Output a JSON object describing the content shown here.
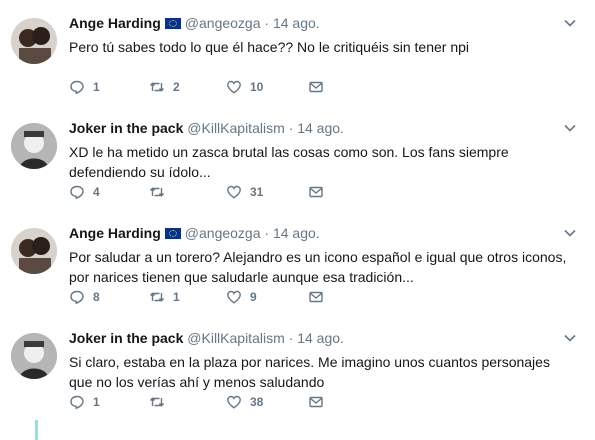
{
  "tweets": [
    {
      "name": "Ange Harding",
      "handle": "@angeozga",
      "sep": "·",
      "time": "14 ago.",
      "text": "Pero tú sabes todo lo que él hace?? No le critiquéis sin tener npi",
      "replies": "1",
      "retweets": "2",
      "likes": "10",
      "flag": true
    },
    {
      "name": "Joker in the pack",
      "handle": "@KillKapitalism",
      "sep": "·",
      "time": "14 ago.",
      "text": "XD le ha metido un zasca brutal las cosas como son. Los fans siempre defendiendo su ídolo...",
      "replies": "4",
      "retweets": "",
      "likes": "31",
      "flag": false
    },
    {
      "name": "Ange Harding",
      "handle": "@angeozga",
      "sep": "·",
      "time": "14 ago.",
      "text": "Por saludar a un torero? Alejandro es un icono español e igual que otros iconos, por narices tienen que saludarle aunque esa tradición...",
      "replies": "8",
      "retweets": "1",
      "likes": "9",
      "flag": true
    },
    {
      "name": "Joker in the pack",
      "handle": "@KillKapitalism",
      "sep": "·",
      "time": "14 ago.",
      "text": "Si claro, estaba en la plaza por narices. Me imagino unos cuantos personajes que no los verías ahí y menos saludando",
      "replies": "1",
      "retweets": "",
      "likes": "38",
      "flag": false
    }
  ],
  "colors": {
    "thread_line": "#99e0dc",
    "muted": "#657786",
    "text": "#14171a"
  },
  "icons": {
    "reply": "reply-icon",
    "retweet": "retweet-icon",
    "like": "heart-icon",
    "dm": "envelope-icon",
    "menu": "chevron-down-icon"
  }
}
